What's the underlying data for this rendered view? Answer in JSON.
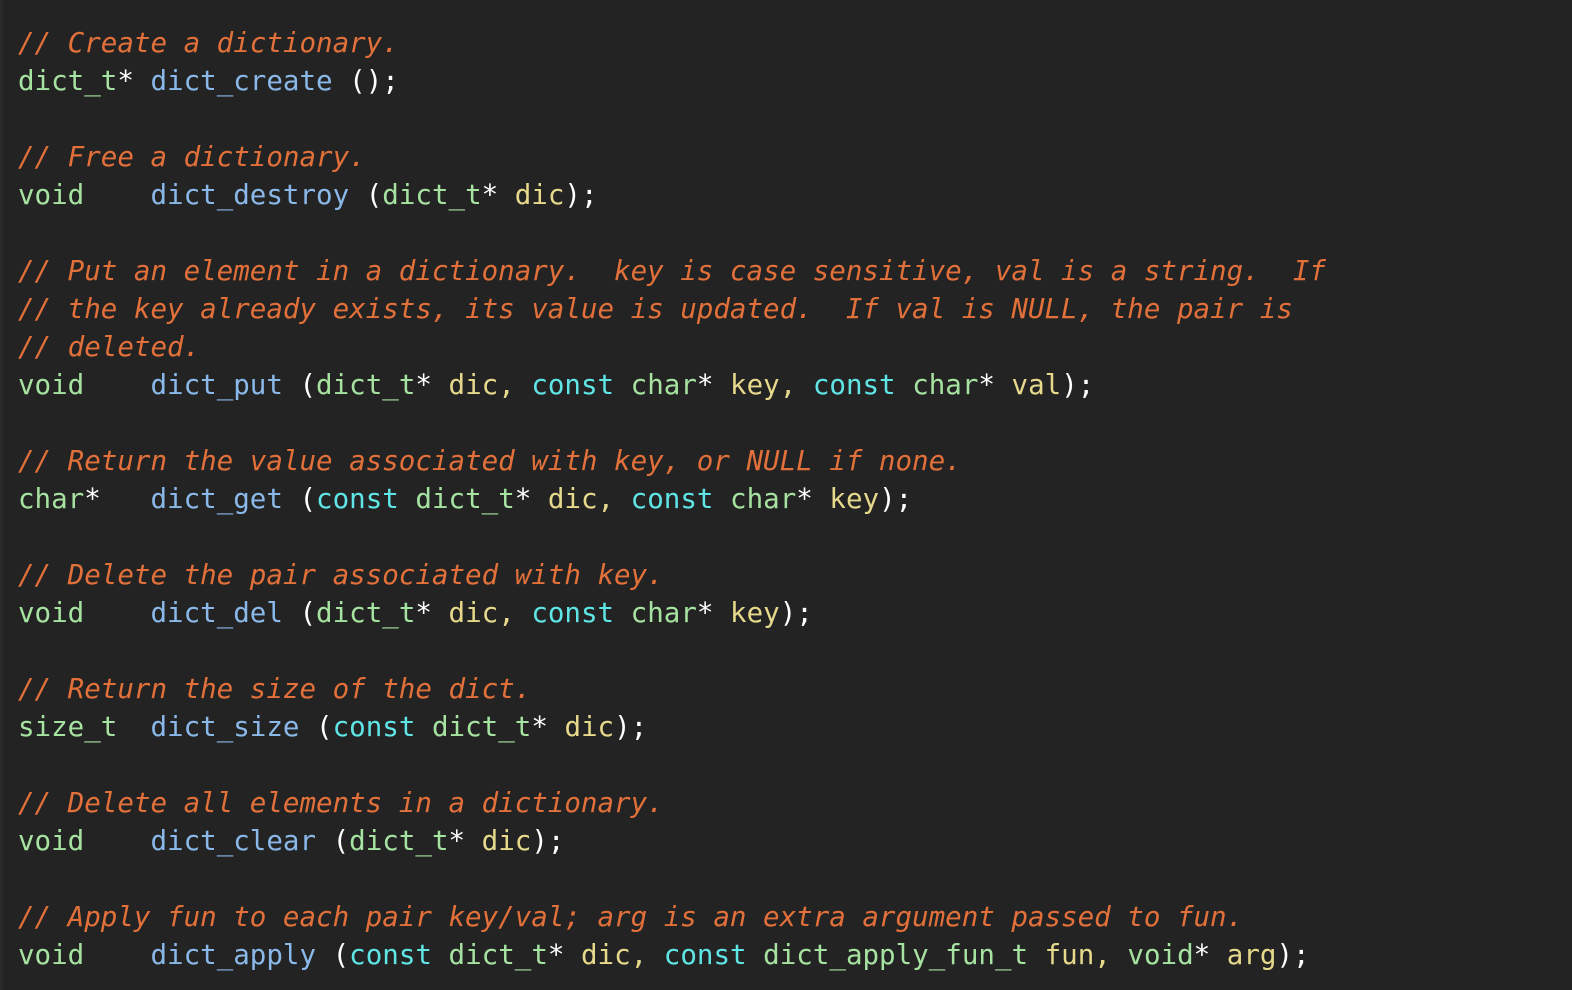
{
  "editor": {
    "background_color": "#232323",
    "font_size_px": 27.5,
    "line_height_px": 38
  },
  "palette": {
    "comment": "#E2703A",
    "type": "#A6E2A0",
    "function": "#8AB8E8",
    "keyword": "#5FE5E5",
    "parameter": "#E6D98C",
    "punctuation": "#FFFFFF",
    "background": "#232323"
  },
  "code": {
    "lines": [
      {
        "index": 1,
        "text": "// Create a dictionary.",
        "tokens": [
          {
            "t": "// Create a dictionary.",
            "c": "comment"
          }
        ]
      },
      {
        "index": 2,
        "text": "dict_t* dict_create ();",
        "tokens": [
          {
            "t": "dict_t",
            "c": "type"
          },
          {
            "t": "*",
            "c": "punct"
          },
          {
            "t": " ",
            "c": "plain"
          },
          {
            "t": "dict_create",
            "c": "func"
          },
          {
            "t": " ",
            "c": "plain"
          },
          {
            "t": "();",
            "c": "punct"
          }
        ]
      },
      {
        "index": 3,
        "text": "",
        "tokens": []
      },
      {
        "index": 4,
        "text": "// Free a dictionary.",
        "tokens": [
          {
            "t": "// Free a dictionary.",
            "c": "comment"
          }
        ]
      },
      {
        "index": 5,
        "text": "void    dict_destroy (dict_t* dic);",
        "tokens": [
          {
            "t": "void",
            "c": "type"
          },
          {
            "t": "    ",
            "c": "plain"
          },
          {
            "t": "dict_destroy",
            "c": "func"
          },
          {
            "t": " ",
            "c": "plain"
          },
          {
            "t": "(",
            "c": "punct"
          },
          {
            "t": "dict_t",
            "c": "type"
          },
          {
            "t": "*",
            "c": "punct"
          },
          {
            "t": " ",
            "c": "plain"
          },
          {
            "t": "dic",
            "c": "param"
          },
          {
            "t": ");",
            "c": "punct"
          }
        ]
      },
      {
        "index": 6,
        "text": "",
        "tokens": []
      },
      {
        "index": 7,
        "text": "// Put an element in a dictionary.  key is case sensitive, val is a string.  If",
        "tokens": [
          {
            "t": "// Put an element in a dictionary.  key is case sensitive, val is a string.  If",
            "c": "comment"
          }
        ]
      },
      {
        "index": 8,
        "text": "// the key already exists, its value is updated.  If val is NULL, the pair is",
        "tokens": [
          {
            "t": "// the key already exists, its value is updated.  If val is NULL, the pair is",
            "c": "comment"
          }
        ]
      },
      {
        "index": 9,
        "text": "// deleted.",
        "tokens": [
          {
            "t": "// deleted.",
            "c": "comment"
          }
        ]
      },
      {
        "index": 10,
        "text": "void    dict_put (dict_t* dic, const char* key, const char* val);",
        "tokens": [
          {
            "t": "void",
            "c": "type"
          },
          {
            "t": "    ",
            "c": "plain"
          },
          {
            "t": "dict_put",
            "c": "func"
          },
          {
            "t": " ",
            "c": "plain"
          },
          {
            "t": "(",
            "c": "punct"
          },
          {
            "t": "dict_t",
            "c": "type"
          },
          {
            "t": "*",
            "c": "punct"
          },
          {
            "t": " ",
            "c": "plain"
          },
          {
            "t": "dic",
            "c": "param"
          },
          {
            "t": ",",
            "c": "param"
          },
          {
            "t": " ",
            "c": "plain"
          },
          {
            "t": "const",
            "c": "keyword"
          },
          {
            "t": " ",
            "c": "plain"
          },
          {
            "t": "char",
            "c": "type"
          },
          {
            "t": "*",
            "c": "punct"
          },
          {
            "t": " ",
            "c": "plain"
          },
          {
            "t": "key",
            "c": "param"
          },
          {
            "t": ",",
            "c": "param"
          },
          {
            "t": " ",
            "c": "plain"
          },
          {
            "t": "const",
            "c": "keyword"
          },
          {
            "t": " ",
            "c": "plain"
          },
          {
            "t": "char",
            "c": "type"
          },
          {
            "t": "*",
            "c": "punct"
          },
          {
            "t": " ",
            "c": "plain"
          },
          {
            "t": "val",
            "c": "param"
          },
          {
            "t": ");",
            "c": "punct"
          }
        ]
      },
      {
        "index": 11,
        "text": "",
        "tokens": []
      },
      {
        "index": 12,
        "text": "// Return the value associated with key, or NULL if none.",
        "tokens": [
          {
            "t": "// Return the value associated with key, or NULL if none.",
            "c": "comment"
          }
        ]
      },
      {
        "index": 13,
        "text": "char*   dict_get (const dict_t* dic, const char* key);",
        "tokens": [
          {
            "t": "char",
            "c": "type"
          },
          {
            "t": "*",
            "c": "punct"
          },
          {
            "t": "   ",
            "c": "plain"
          },
          {
            "t": "dict_get",
            "c": "func"
          },
          {
            "t": " ",
            "c": "plain"
          },
          {
            "t": "(",
            "c": "punct"
          },
          {
            "t": "const",
            "c": "keyword"
          },
          {
            "t": " ",
            "c": "plain"
          },
          {
            "t": "dict_t",
            "c": "type"
          },
          {
            "t": "*",
            "c": "punct"
          },
          {
            "t": " ",
            "c": "plain"
          },
          {
            "t": "dic",
            "c": "param"
          },
          {
            "t": ",",
            "c": "param"
          },
          {
            "t": " ",
            "c": "plain"
          },
          {
            "t": "const",
            "c": "keyword"
          },
          {
            "t": " ",
            "c": "plain"
          },
          {
            "t": "char",
            "c": "type"
          },
          {
            "t": "*",
            "c": "punct"
          },
          {
            "t": " ",
            "c": "plain"
          },
          {
            "t": "key",
            "c": "param"
          },
          {
            "t": ");",
            "c": "punct"
          }
        ]
      },
      {
        "index": 14,
        "text": "",
        "tokens": []
      },
      {
        "index": 15,
        "text": "// Delete the pair associated with key.",
        "tokens": [
          {
            "t": "// Delete the pair associated with key.",
            "c": "comment"
          }
        ]
      },
      {
        "index": 16,
        "text": "void    dict_del (dict_t* dic, const char* key);",
        "tokens": [
          {
            "t": "void",
            "c": "type"
          },
          {
            "t": "    ",
            "c": "plain"
          },
          {
            "t": "dict_del",
            "c": "func"
          },
          {
            "t": " ",
            "c": "plain"
          },
          {
            "t": "(",
            "c": "punct"
          },
          {
            "t": "dict_t",
            "c": "type"
          },
          {
            "t": "*",
            "c": "punct"
          },
          {
            "t": " ",
            "c": "plain"
          },
          {
            "t": "dic",
            "c": "param"
          },
          {
            "t": ",",
            "c": "param"
          },
          {
            "t": " ",
            "c": "plain"
          },
          {
            "t": "const",
            "c": "keyword"
          },
          {
            "t": " ",
            "c": "plain"
          },
          {
            "t": "char",
            "c": "type"
          },
          {
            "t": "*",
            "c": "punct"
          },
          {
            "t": " ",
            "c": "plain"
          },
          {
            "t": "key",
            "c": "param"
          },
          {
            "t": ");",
            "c": "punct"
          }
        ]
      },
      {
        "index": 17,
        "text": "",
        "tokens": []
      },
      {
        "index": 18,
        "text": "// Return the size of the dict.",
        "tokens": [
          {
            "t": "// Return the size of the dict.",
            "c": "comment"
          }
        ]
      },
      {
        "index": 19,
        "text": "size_t  dict_size (const dict_t* dic);",
        "tokens": [
          {
            "t": "size_t",
            "c": "type"
          },
          {
            "t": "  ",
            "c": "plain"
          },
          {
            "t": "dict_size",
            "c": "func"
          },
          {
            "t": " ",
            "c": "plain"
          },
          {
            "t": "(",
            "c": "punct"
          },
          {
            "t": "const",
            "c": "keyword"
          },
          {
            "t": " ",
            "c": "plain"
          },
          {
            "t": "dict_t",
            "c": "type"
          },
          {
            "t": "*",
            "c": "punct"
          },
          {
            "t": " ",
            "c": "plain"
          },
          {
            "t": "dic",
            "c": "param"
          },
          {
            "t": ");",
            "c": "punct"
          }
        ]
      },
      {
        "index": 20,
        "text": "",
        "tokens": []
      },
      {
        "index": 21,
        "text": "// Delete all elements in a dictionary.",
        "tokens": [
          {
            "t": "// Delete all elements in a dictionary.",
            "c": "comment"
          }
        ]
      },
      {
        "index": 22,
        "text": "void    dict_clear (dict_t* dic);",
        "tokens": [
          {
            "t": "void",
            "c": "type"
          },
          {
            "t": "    ",
            "c": "plain"
          },
          {
            "t": "dict_clear",
            "c": "func"
          },
          {
            "t": " ",
            "c": "plain"
          },
          {
            "t": "(",
            "c": "punct"
          },
          {
            "t": "dict_t",
            "c": "type"
          },
          {
            "t": "*",
            "c": "punct"
          },
          {
            "t": " ",
            "c": "plain"
          },
          {
            "t": "dic",
            "c": "param"
          },
          {
            "t": ");",
            "c": "punct"
          }
        ]
      },
      {
        "index": 23,
        "text": "",
        "tokens": []
      },
      {
        "index": 24,
        "text": "// Apply fun to each pair key/val; arg is an extra argument passed to fun.",
        "tokens": [
          {
            "t": "// Apply fun to each pair key/val; arg is an extra argument passed to fun.",
            "c": "comment"
          }
        ]
      },
      {
        "index": 25,
        "text": "void    dict_apply (const dict_t* dic, const dict_apply_fun_t fun, void* arg);",
        "tokens": [
          {
            "t": "void",
            "c": "type"
          },
          {
            "t": "    ",
            "c": "plain"
          },
          {
            "t": "dict_apply",
            "c": "func"
          },
          {
            "t": " ",
            "c": "plain"
          },
          {
            "t": "(",
            "c": "punct"
          },
          {
            "t": "const",
            "c": "keyword"
          },
          {
            "t": " ",
            "c": "plain"
          },
          {
            "t": "dict_t",
            "c": "type"
          },
          {
            "t": "*",
            "c": "punct"
          },
          {
            "t": " ",
            "c": "plain"
          },
          {
            "t": "dic",
            "c": "param"
          },
          {
            "t": ",",
            "c": "param"
          },
          {
            "t": " ",
            "c": "plain"
          },
          {
            "t": "const",
            "c": "keyword"
          },
          {
            "t": " ",
            "c": "plain"
          },
          {
            "t": "dict_apply_fun_t",
            "c": "type"
          },
          {
            "t": " ",
            "c": "plain"
          },
          {
            "t": "fun",
            "c": "param"
          },
          {
            "t": ",",
            "c": "param"
          },
          {
            "t": " ",
            "c": "plain"
          },
          {
            "t": "void",
            "c": "type"
          },
          {
            "t": "*",
            "c": "punct"
          },
          {
            "t": " ",
            "c": "plain"
          },
          {
            "t": "arg",
            "c": "param"
          },
          {
            "t": ");",
            "c": "punct"
          }
        ]
      }
    ]
  }
}
